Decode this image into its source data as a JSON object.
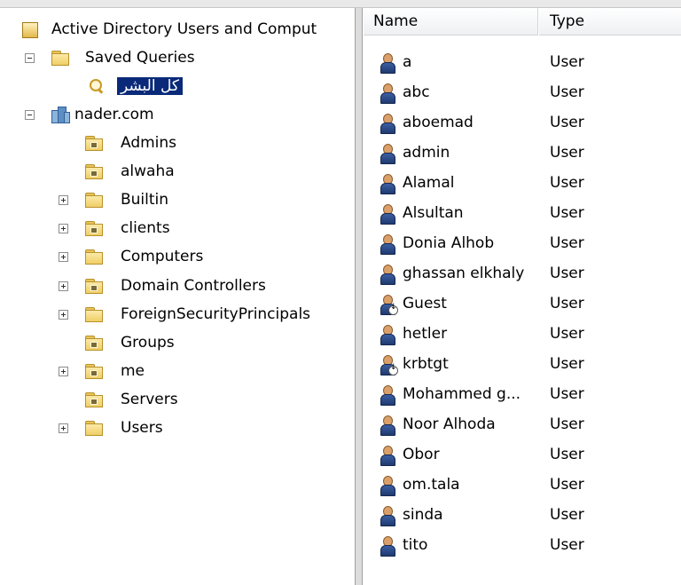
{
  "tree": {
    "root": {
      "label": "Active Directory Users and Comput"
    },
    "saved_queries": {
      "label": "Saved Queries",
      "expander": "minus"
    },
    "query": {
      "label": "كل البشر"
    },
    "domain": {
      "label": "nader.com",
      "expander": "minus"
    },
    "children": [
      {
        "label": "Admins",
        "expander": "none",
        "icon": "ou-folder-icon"
      },
      {
        "label": "alwaha",
        "expander": "none",
        "icon": "ou-folder-icon"
      },
      {
        "label": "Builtin",
        "expander": "plus",
        "icon": "container-folder-icon"
      },
      {
        "label": "clients",
        "expander": "plus",
        "icon": "ou-folder-icon"
      },
      {
        "label": "Computers",
        "expander": "plus",
        "icon": "container-folder-icon"
      },
      {
        "label": "Domain Controllers",
        "expander": "plus",
        "icon": "ou-folder-icon"
      },
      {
        "label": "ForeignSecurityPrincipals",
        "expander": "plus",
        "icon": "container-folder-icon"
      },
      {
        "label": "Groups",
        "expander": "none",
        "icon": "ou-folder-icon"
      },
      {
        "label": "me",
        "expander": "plus",
        "icon": "ou-folder-icon"
      },
      {
        "label": "Servers",
        "expander": "none",
        "icon": "ou-folder-icon"
      },
      {
        "label": "Users",
        "expander": "plus",
        "icon": "container-folder-icon"
      }
    ]
  },
  "list": {
    "columns": {
      "name": "Name",
      "type": "Type"
    },
    "rows": [
      {
        "name": "a",
        "type": "User",
        "disabled": false
      },
      {
        "name": "abc",
        "type": "User",
        "disabled": false
      },
      {
        "name": "aboemad",
        "type": "User",
        "disabled": false
      },
      {
        "name": "admin",
        "type": "User",
        "disabled": false
      },
      {
        "name": "Alamal",
        "type": "User",
        "disabled": false
      },
      {
        "name": "Alsultan",
        "type": "User",
        "disabled": false
      },
      {
        "name": "Donia Alhob",
        "type": "User",
        "disabled": false
      },
      {
        "name": "ghassan elkhaly",
        "type": "User",
        "disabled": false
      },
      {
        "name": "Guest",
        "type": "User",
        "disabled": true
      },
      {
        "name": "hetler",
        "type": "User",
        "disabled": false
      },
      {
        "name": "krbtgt",
        "type": "User",
        "disabled": true
      },
      {
        "name": "Mohammed g...",
        "type": "User",
        "disabled": false
      },
      {
        "name": "Noor Alhoda",
        "type": "User",
        "disabled": false
      },
      {
        "name": "Obor",
        "type": "User",
        "disabled": false
      },
      {
        "name": "om.tala",
        "type": "User",
        "disabled": false
      },
      {
        "name": "sinda",
        "type": "User",
        "disabled": false
      },
      {
        "name": "tito",
        "type": "User",
        "disabled": false
      }
    ]
  },
  "colors": {
    "selection": "#0a2a79",
    "folder": "#f0cf67"
  }
}
